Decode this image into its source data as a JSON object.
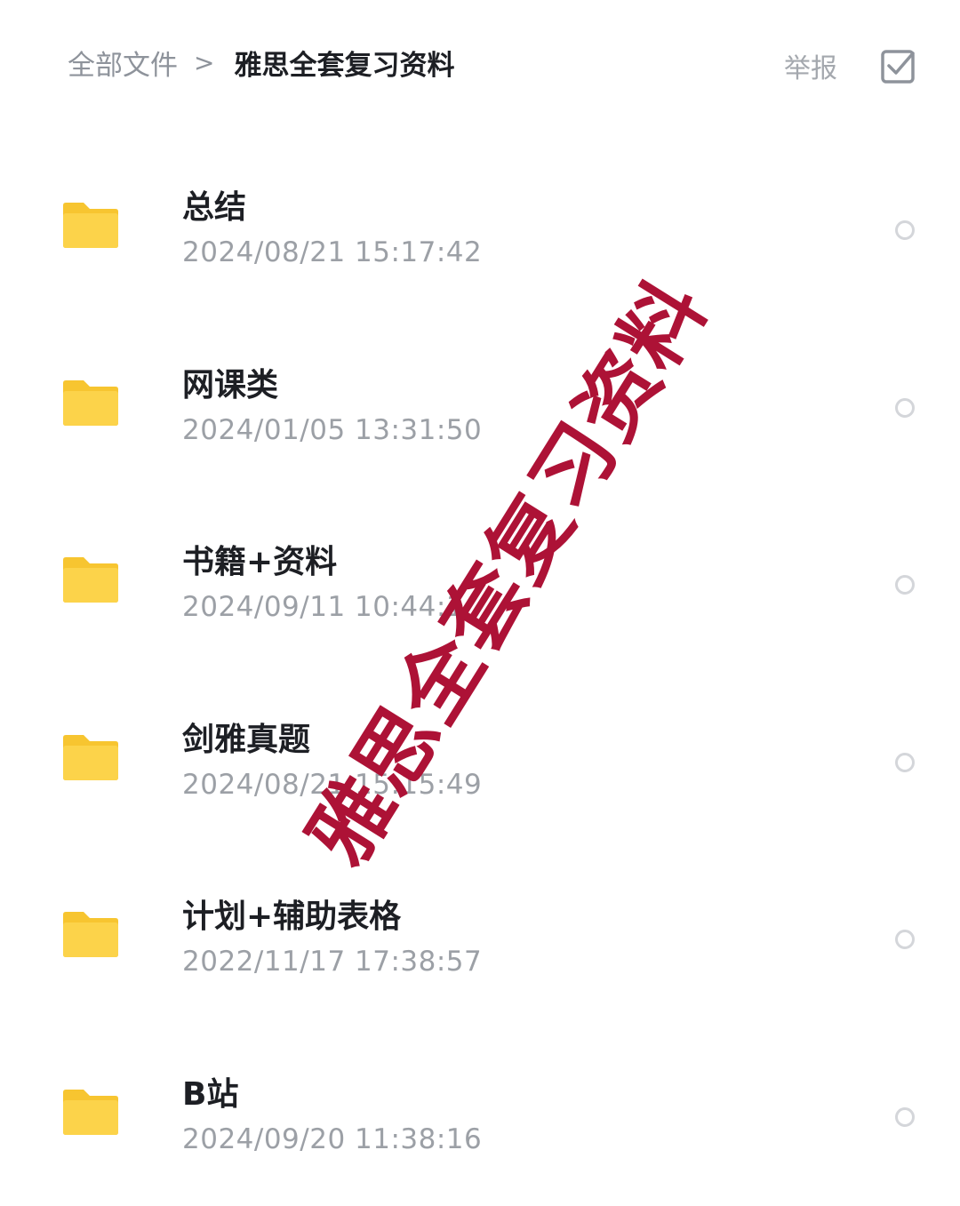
{
  "breadcrumb": {
    "root": "全部文件",
    "separator": ">",
    "current": "雅思全套复习资料"
  },
  "header": {
    "report_label": "举报",
    "select_icon": "checkbox-icon"
  },
  "files": [
    {
      "name": "总结",
      "date": "2024/08/21 15:17:42",
      "icon": "folder-icon"
    },
    {
      "name": "网课类",
      "date": "2024/01/05 13:31:50",
      "icon": "folder-icon"
    },
    {
      "name": "书籍+资料",
      "date": "2024/09/11 10:44:1",
      "icon": "folder-icon"
    },
    {
      "name": "剑雅真题",
      "date": "2024/08/21 15:15:49",
      "icon": "folder-icon"
    },
    {
      "name": "计划+辅助表格",
      "date": "2022/11/17 17:38:57",
      "icon": "folder-icon"
    },
    {
      "name": "B站",
      "date": "2024/09/20 11:38:16",
      "icon": "folder-icon"
    }
  ],
  "watermark": {
    "text": "雅思全套复习资料",
    "color": "#ad1236"
  },
  "colors": {
    "folder": "#fcd34a",
    "folder_tab": "#f7c530",
    "accent_text": "#1d1f24",
    "muted_text": "#9ca0a6"
  }
}
